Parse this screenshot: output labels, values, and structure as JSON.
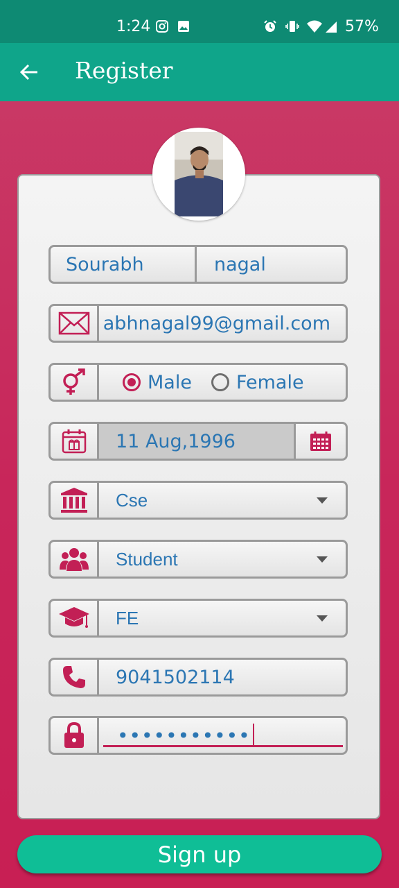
{
  "status_bar": {
    "time": "1:24",
    "battery": "57%",
    "icons": [
      "instagram-icon",
      "image-icon",
      "alarm-icon",
      "vibrate-icon",
      "wifi-icon",
      "signal-icon"
    ]
  },
  "app_bar": {
    "title": "Register",
    "back_icon": "arrow-left-icon"
  },
  "form": {
    "first_name": "Sourabh",
    "last_name": "nagal",
    "email": "abhnagal99@gmail.com",
    "gender": {
      "options": [
        "Male",
        "Female"
      ],
      "selected": "Male"
    },
    "date_of_birth": "11 Aug,1996",
    "department": "Cse",
    "role": "Student",
    "year": "FE",
    "phone": "9041502114",
    "password_mask": "•••••••••••"
  },
  "signup_label": "Sign up",
  "colors": {
    "accent": "#c21f55",
    "teal": "#0fa58a",
    "status_bar": "#0e8a73",
    "button": "#0fbe96",
    "text_blue": "#2b76b3"
  }
}
